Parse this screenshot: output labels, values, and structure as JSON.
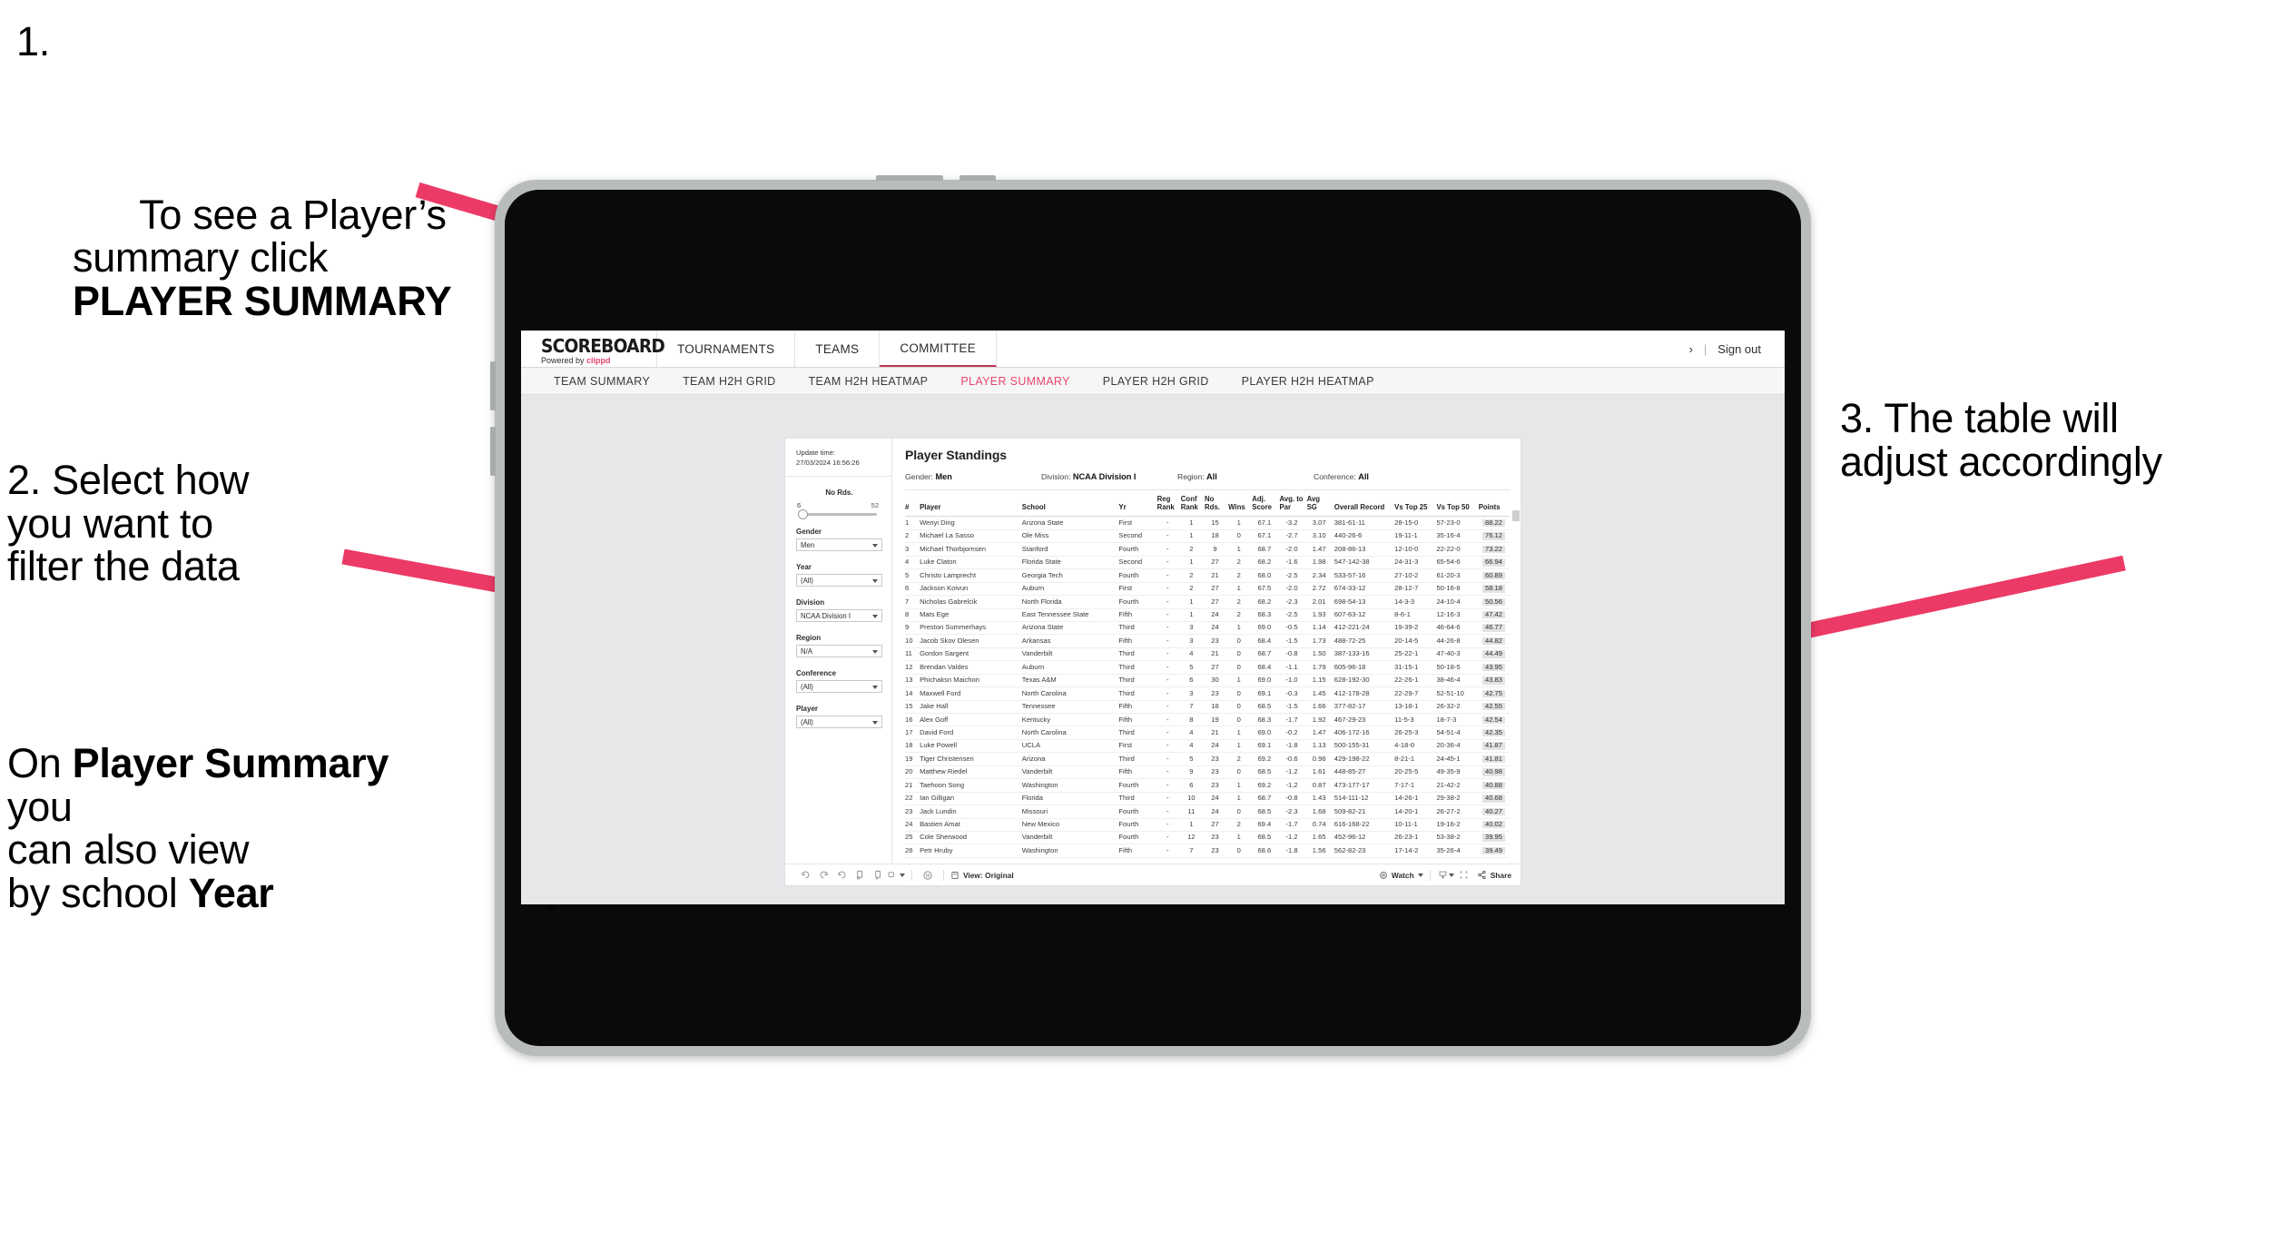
{
  "annotations": {
    "step1_num": "1.",
    "step1_pre": "To see a Player’s\nsummary click ",
    "step1_bold": "PLAYER SUMMARY",
    "step2": "2. Select how\nyou want to\nfilter the data",
    "step3_a": "On ",
    "step3_b1": "Player Summary",
    "step3_c": " you\ncan also view\nby school ",
    "step3_b2": "Year",
    "step4": "3. The table will\nadjust accordingly"
  },
  "colors": {
    "arrow_pink": "#ec3a66",
    "brand_pink": "#e8456f",
    "active_tab": "#e8456f",
    "underline": "#c2365a",
    "canvas_bg": "#e6e7e9",
    "bezel": "#b9bcbd",
    "screen_black": "#0a0a0a"
  },
  "app": {
    "logo_main": "SCOREBOARD",
    "logo_sub_prefix": "Powered by ",
    "logo_sub_brand": "clippd",
    "topnav": [
      {
        "label": "TOURNAMENTS",
        "active": false
      },
      {
        "label": "TEAMS",
        "active": false
      },
      {
        "label": "COMMITTEE",
        "active": true
      }
    ],
    "topbar_right": {
      "truncated": "›",
      "separator": "|",
      "signout": "Sign out"
    },
    "subnav": [
      {
        "label": "TEAM SUMMARY",
        "active": false
      },
      {
        "label": "TEAM H2H GRID",
        "active": false
      },
      {
        "label": "TEAM H2H HEATMAP",
        "active": false
      },
      {
        "label": "PLAYER SUMMARY",
        "active": true
      },
      {
        "label": "PLAYER H2H GRID",
        "active": false
      },
      {
        "label": "PLAYER H2H HEATMAP",
        "active": false
      }
    ]
  },
  "viz": {
    "update_time_label": "Update time:",
    "update_time_value": "27/03/2024 16:56:26",
    "title": "Player Standings",
    "meta": [
      {
        "label": "Gender:",
        "value": "Men"
      },
      {
        "label": "Division:",
        "value": "NCAA Division I"
      },
      {
        "label": "Region:",
        "value": "All"
      },
      {
        "label": "Conference:",
        "value": "All"
      }
    ],
    "filters": {
      "rounds": {
        "label": "No Rds.",
        "min": "6",
        "max": "52"
      },
      "gender": {
        "label": "Gender",
        "value": "Men"
      },
      "year": {
        "label": "Year",
        "value": "(All)"
      },
      "division": {
        "label": "Division",
        "value": "NCAA Division I"
      },
      "region": {
        "label": "Region",
        "value": "N/A"
      },
      "conference": {
        "label": "Conference",
        "value": "(All)"
      },
      "player": {
        "label": "Player",
        "value": "(All)"
      }
    },
    "toolbar": {
      "view_label": "View: Original",
      "watch_label": "Watch",
      "share_label": "Share"
    }
  },
  "chart_data": {
    "type": "table",
    "title": "Player Standings",
    "columns": [
      "#",
      "Player",
      "School",
      "Yr",
      "Reg Rank",
      "Conf Rank",
      "No Rds.",
      "Wins",
      "Adj. Score",
      "Avg. to Par",
      "Avg SG",
      "Overall Record",
      "Vs Top 25",
      "Vs Top 50",
      "Points"
    ],
    "rows": [
      [
        "1",
        "Wenyi Ding",
        "Arizona State",
        "First",
        "-",
        "1",
        "15",
        "1",
        "67.1",
        "-3.2",
        "3.07",
        "381-61-11",
        "28-15-0",
        "57-23-0",
        "88.22"
      ],
      [
        "2",
        "Michael La Sasso",
        "Ole Miss",
        "Second",
        "-",
        "1",
        "18",
        "0",
        "67.1",
        "-2.7",
        "3.10",
        "440-26-6",
        "19-11-1",
        "35-16-4",
        "76.12"
      ],
      [
        "3",
        "Michael Thorbjornsen",
        "Stanford",
        "Fourth",
        "-",
        "2",
        "9",
        "1",
        "68.7",
        "-2.0",
        "1.47",
        "208-86-13",
        "12-10-0",
        "22-22-0",
        "73.22"
      ],
      [
        "4",
        "Luke Claton",
        "Florida State",
        "Second",
        "-",
        "1",
        "27",
        "2",
        "68.2",
        "-1.6",
        "1.98",
        "547-142-38",
        "24-31-3",
        "65-54-6",
        "66.94"
      ],
      [
        "5",
        "Christo Lamprecht",
        "Georgia Tech",
        "Fourth",
        "-",
        "2",
        "21",
        "2",
        "68.0",
        "-2.5",
        "2.34",
        "533-57-16",
        "27-10-2",
        "61-20-3",
        "60.89"
      ],
      [
        "6",
        "Jackson Koivun",
        "Auburn",
        "First",
        "-",
        "2",
        "27",
        "1",
        "67.5",
        "-2.0",
        "2.72",
        "674-33-12",
        "28-12-7",
        "50-16-8",
        "58.18"
      ],
      [
        "7",
        "Nicholas Gabrelcik",
        "North Florida",
        "Fourth",
        "-",
        "1",
        "27",
        "2",
        "68.2",
        "-2.3",
        "2.01",
        "698-54-13",
        "14-3-3",
        "24-10-4",
        "50.56"
      ],
      [
        "8",
        "Mats Ege",
        "East Tennessee State",
        "Fifth",
        "-",
        "1",
        "24",
        "2",
        "68.3",
        "-2.5",
        "1.93",
        "607-63-12",
        "8-6-1",
        "12-16-3",
        "47.42"
      ],
      [
        "9",
        "Preston Summerhays",
        "Arizona State",
        "Third",
        "-",
        "3",
        "24",
        "1",
        "69.0",
        "-0.5",
        "1.14",
        "412-221-24",
        "19-39-2",
        "46-64-6",
        "46.77"
      ],
      [
        "10",
        "Jacob Skov Olesen",
        "Arkansas",
        "Fifth",
        "-",
        "3",
        "23",
        "0",
        "68.4",
        "-1.5",
        "1.73",
        "488-72-25",
        "20-14-5",
        "44-26-8",
        "44.82"
      ],
      [
        "11",
        "Gordon Sargent",
        "Vanderbilt",
        "Third",
        "-",
        "4",
        "21",
        "0",
        "68.7",
        "-0.8",
        "1.50",
        "387-133-16",
        "25-22-1",
        "47-40-3",
        "44.49"
      ],
      [
        "12",
        "Brendan Valdes",
        "Auburn",
        "Third",
        "-",
        "5",
        "27",
        "0",
        "68.4",
        "-1.1",
        "1.79",
        "605-96-18",
        "31-15-1",
        "50-18-5",
        "43.95"
      ],
      [
        "13",
        "Phichaksn Maichon",
        "Texas A&M",
        "Third",
        "-",
        "6",
        "30",
        "1",
        "69.0",
        "-1.0",
        "1.15",
        "628-192-30",
        "22-26-1",
        "38-46-4",
        "43.83"
      ],
      [
        "14",
        "Maxwell Ford",
        "North Carolina",
        "Third",
        "-",
        "3",
        "23",
        "0",
        "69.1",
        "-0.3",
        "1.45",
        "412-178-28",
        "22-29-7",
        "52-51-10",
        "42.75"
      ],
      [
        "15",
        "Jake Hall",
        "Tennessee",
        "Fifth",
        "-",
        "7",
        "18",
        "0",
        "68.5",
        "-1.5",
        "1.66",
        "377-82-17",
        "13-18-1",
        "26-32-2",
        "42.55"
      ],
      [
        "16",
        "Alex Goff",
        "Kentucky",
        "Fifth",
        "-",
        "8",
        "19",
        "0",
        "68.3",
        "-1.7",
        "1.92",
        "467-29-23",
        "11-5-3",
        "18-7-3",
        "42.54"
      ],
      [
        "17",
        "David Ford",
        "North Carolina",
        "Third",
        "-",
        "4",
        "21",
        "1",
        "69.0",
        "-0.2",
        "1.47",
        "406-172-16",
        "26-25-3",
        "54-51-4",
        "42.35"
      ],
      [
        "18",
        "Luke Powell",
        "UCLA",
        "First",
        "-",
        "4",
        "24",
        "1",
        "69.1",
        "-1.8",
        "1.13",
        "500-155-31",
        "4-18-0",
        "20-36-4",
        "41.87"
      ],
      [
        "19",
        "Tiger Christensen",
        "Arizona",
        "Third",
        "-",
        "5",
        "23",
        "2",
        "69.2",
        "-0.6",
        "0.96",
        "429-198-22",
        "8-21-1",
        "24-45-1",
        "41.81"
      ],
      [
        "20",
        "Matthew Riedel",
        "Vanderbilt",
        "Fifth",
        "-",
        "9",
        "23",
        "0",
        "68.5",
        "-1.2",
        "1.61",
        "448-85-27",
        "20-25-5",
        "49-35-9",
        "40.98"
      ],
      [
        "21",
        "Taehoon Song",
        "Washington",
        "Fourth",
        "-",
        "6",
        "23",
        "1",
        "69.2",
        "-1.2",
        "0.87",
        "473-177-17",
        "7-17-1",
        "21-42-2",
        "40.88"
      ],
      [
        "22",
        "Ian Gilligan",
        "Florida",
        "Third",
        "-",
        "10",
        "24",
        "1",
        "68.7",
        "-0.8",
        "1.43",
        "514-111-12",
        "14-26-1",
        "29-38-2",
        "40.68"
      ],
      [
        "23",
        "Jack Lundin",
        "Missouri",
        "Fourth",
        "-",
        "11",
        "24",
        "0",
        "68.5",
        "-2.3",
        "1.68",
        "509-82-21",
        "14-20-1",
        "26-27-2",
        "40.27"
      ],
      [
        "24",
        "Bastien Amat",
        "New Mexico",
        "Fourth",
        "-",
        "1",
        "27",
        "2",
        "69.4",
        "-1.7",
        "0.74",
        "616-168-22",
        "10-11-1",
        "19-16-2",
        "40.02"
      ],
      [
        "25",
        "Cole Sherwood",
        "Vanderbilt",
        "Fourth",
        "-",
        "12",
        "23",
        "1",
        "68.5",
        "-1.2",
        "1.65",
        "452-96-12",
        "26-23-1",
        "53-38-2",
        "39.95"
      ],
      [
        "26",
        "Petr Hruby",
        "Washington",
        "Fifth",
        "-",
        "7",
        "23",
        "0",
        "68.6",
        "-1.8",
        "1.56",
        "562-82-23",
        "17-14-2",
        "35-26-4",
        "39.49"
      ]
    ]
  }
}
